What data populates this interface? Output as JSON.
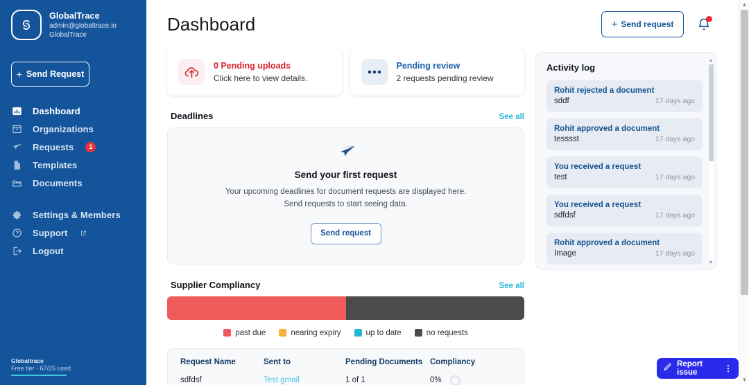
{
  "sidebar": {
    "brand": {
      "name": "GlobalTrace",
      "email": "admin@globaltrace.io",
      "org": "GlobalTrace",
      "logo_icon": "globaltrace-logo-icon"
    },
    "send_request_label": "Send Request",
    "items": [
      {
        "label": "Dashboard",
        "icon": "chart-bar-icon",
        "active": true,
        "badge": ""
      },
      {
        "label": "Organizations",
        "icon": "archive-box-icon",
        "active": false,
        "badge": ""
      },
      {
        "label": "Requests",
        "icon": "paper-plane-icon",
        "active": false,
        "badge": "1"
      },
      {
        "label": "Templates",
        "icon": "document-icon",
        "active": false,
        "badge": ""
      },
      {
        "label": "Documents",
        "icon": "folder-icon",
        "active": false,
        "badge": ""
      }
    ],
    "items_secondary": [
      {
        "label": "Settings & Members",
        "icon": "gear-icon",
        "external": false
      },
      {
        "label": "Support",
        "icon": "question-circle-icon",
        "external": true
      },
      {
        "label": "Logout",
        "icon": "logout-icon",
        "external": false
      }
    ],
    "tier": {
      "name": "Globaltrace",
      "plan": "Free tier - 67/25 used"
    },
    "bg_color": "#14549b"
  },
  "header": {
    "title": "Dashboard",
    "send_request_label": "Send request",
    "bell_icon": "bell-icon",
    "has_notification": true,
    "accent_color": "#14549b"
  },
  "stats": [
    {
      "title": "0 Pending uploads",
      "sub": "Click here to view details.",
      "icon": "cloud-upload-icon",
      "color": "#d7232f"
    },
    {
      "title": "Pending review",
      "sub": "2 requests pending review",
      "icon": "three-dots-icon",
      "color": "#1e5fa8"
    }
  ],
  "deadlines": {
    "section_title": "Deadlines",
    "see_all": "See all",
    "empty_icon": "paper-plane-icon",
    "empty_title": "Send your first request",
    "empty_line1": "Your upcoming deadlines for document requests are displayed here.",
    "empty_line2": "Send requests to start seeing data.",
    "empty_button": "Send request"
  },
  "compliancy": {
    "section_title": "Supplier Compliancy",
    "see_all": "See all",
    "segments": [
      {
        "label": "past due",
        "color": "#ef5a5a",
        "percent": 50
      },
      {
        "label": "no requests",
        "color": "#4b4b4b",
        "percent": 50
      }
    ],
    "legend": [
      {
        "label": "past due",
        "color": "#ef5a5a"
      },
      {
        "label": "nearing expiry",
        "color": "#f5b23c"
      },
      {
        "label": "up to date",
        "color": "#1fb9d4"
      },
      {
        "label": "no requests",
        "color": "#4b4b4b"
      }
    ]
  },
  "chart_data": {
    "type": "bar",
    "title": "Supplier Compliancy",
    "categories": [
      "past due",
      "nearing expiry",
      "up to date",
      "no requests"
    ],
    "values": [
      50,
      0,
      0,
      50
    ],
    "colors": [
      "#ef5a5a",
      "#f5b23c",
      "#1fb9d4",
      "#4b4b4b"
    ],
    "xlabel": "",
    "ylabel": "",
    "ylim": [
      0,
      100
    ],
    "legend_position": "bottom",
    "grid": false,
    "orientation": "horizontal-stacked"
  },
  "requests_table": {
    "columns": [
      "Request Name",
      "Sent to",
      "Pending Documents",
      "Compliancy"
    ],
    "rows": [
      {
        "name": "sdfdsf",
        "sent_to": "Test gmail",
        "pending": "1 of 1",
        "compliancy": "0%"
      }
    ]
  },
  "activity_log": {
    "title": "Activity log",
    "items": [
      {
        "head": "Rohit rejected a document",
        "sub": "sddf",
        "time": "17 days ago"
      },
      {
        "head": "Rohit approved a document",
        "sub": "tesssst",
        "time": "17 days ago"
      },
      {
        "head": "You received a request",
        "sub": "test",
        "time": "17 days ago"
      },
      {
        "head": "You received a request",
        "sub": "sdfdsf",
        "time": "17 days ago"
      },
      {
        "head": "Rohit approved a document",
        "sub": "Image",
        "time": "17 days ago"
      }
    ]
  },
  "report_issue": {
    "label": "Report issue",
    "icon": "pencil-icon",
    "menu_icon": "kebab-menu-icon",
    "color": "#2a2aea"
  }
}
